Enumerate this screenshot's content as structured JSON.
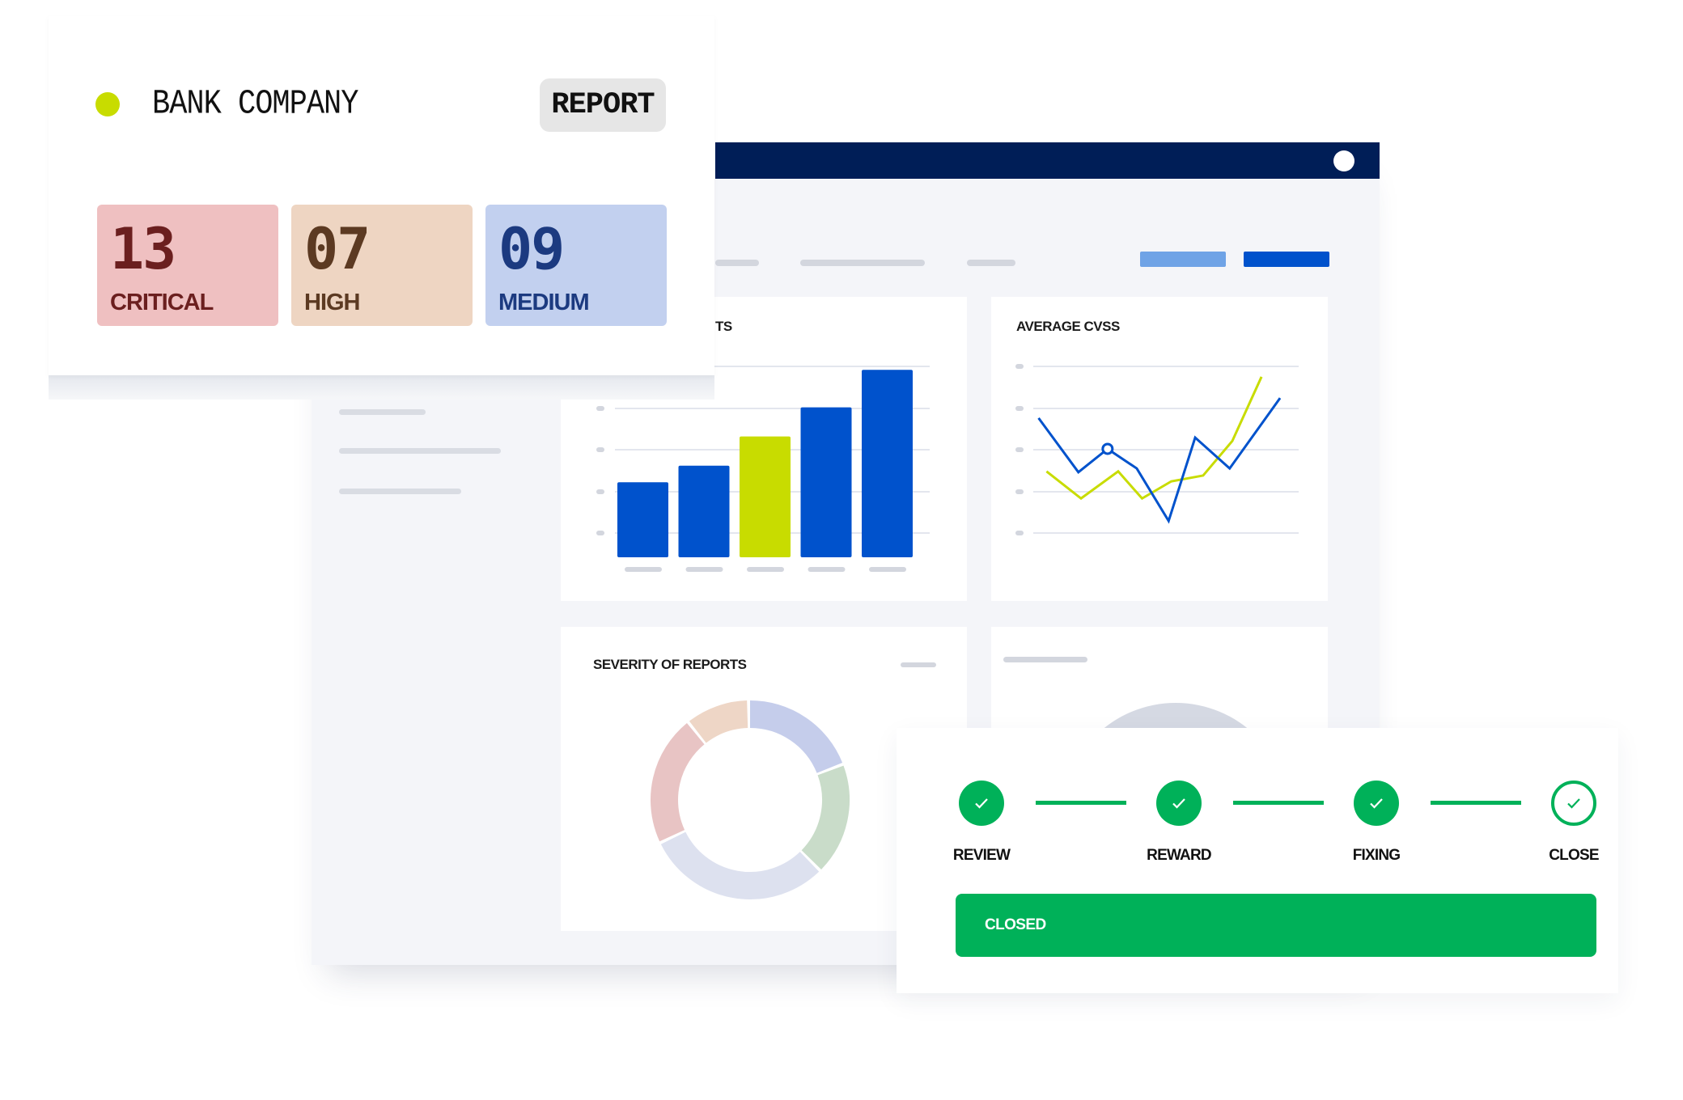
{
  "company": {
    "name": "BANK COMPANY",
    "status_color": "#c8dc00",
    "report_button": "REPORT"
  },
  "severity_tiles": [
    {
      "count": "13",
      "label": "CRITICAL",
      "bg": "#efc0c1",
      "fg": "#6b1f1f"
    },
    {
      "count": "07",
      "label": "HIGH",
      "bg": "#eed5c2",
      "fg": "#5c3a22"
    },
    {
      "count": "09",
      "label": "MEDIUM",
      "bg": "#c2d0ef",
      "fg": "#1c3a80"
    }
  ],
  "dashboard": {
    "header_color": "#001e57",
    "bar_card_title": "TS",
    "line_card_title": "AVERAGE CVSS",
    "donut_card_title": "SEVERITY OF REPORTS"
  },
  "chart_data": [
    {
      "type": "bar",
      "title": "TS",
      "categories": [
        "",
        "",
        "",
        "",
        ""
      ],
      "values": [
        1.8,
        2.2,
        2.9,
        3.6,
        4.5
      ],
      "ylim": [
        0,
        5
      ],
      "colors": [
        "#0052cc",
        "#0052cc",
        "#c8dc00",
        "#0052cc",
        "#0052cc"
      ],
      "grid": true
    },
    {
      "type": "line",
      "title": "AVERAGE CVSS",
      "xlim": [
        0,
        10
      ],
      "ylim": [
        0,
        4
      ],
      "grid": true,
      "series": [
        {
          "color": "#0052cc",
          "x": [
            0.2,
            1.7,
            2.8,
            3.9,
            5.1,
            6.1,
            7.4,
            9.3
          ],
          "y": [
            2.76,
            1.46,
            2.02,
            1.55,
            0.29,
            2.29,
            1.55,
            3.24
          ],
          "marker_index": 2
        },
        {
          "color": "#c8dc00",
          "x": [
            0.5,
            1.8,
            3.2,
            4.1,
            5.2,
            6.4,
            7.5,
            8.6
          ],
          "y": [
            1.48,
            0.83,
            1.48,
            0.83,
            1.24,
            1.38,
            2.21,
            3.75
          ]
        }
      ]
    },
    {
      "type": "pie",
      "title": "SEVERITY OF REPORTS",
      "donut": true,
      "values": [
        19,
        18,
        30,
        21,
        10
      ],
      "colors": [
        "#c5cdeb",
        "#c9dcc9",
        "#dde1ef",
        "#e8c4c4",
        "#eed6c6"
      ]
    }
  ],
  "workflow": {
    "steps": [
      {
        "label": "REVIEW",
        "done": true
      },
      {
        "label": "REWARD",
        "done": true
      },
      {
        "label": "FIXING",
        "done": true
      },
      {
        "label": "CLOSE",
        "done": false
      }
    ],
    "status": "CLOSED",
    "color": "#00b159"
  }
}
